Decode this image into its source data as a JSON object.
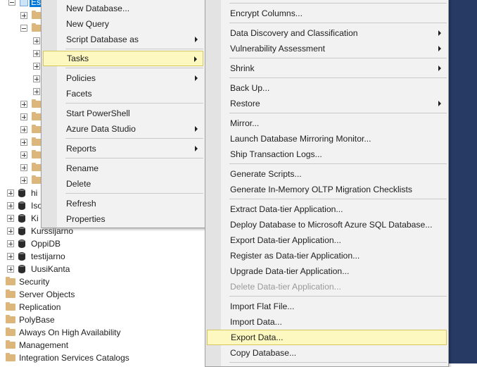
{
  "tree": {
    "selected_db": "Es",
    "databases": [
      "hi",
      "Iso",
      "Ki",
      "Kurssijarno",
      "OppiDB",
      "testijarno",
      "UusiKanta"
    ],
    "root_folders": [
      "Security",
      "Server Objects",
      "Replication",
      "PolyBase",
      "Always On High Availability",
      "Management",
      "Integration Services Catalogs"
    ]
  },
  "context_menu": {
    "items": [
      {
        "label": "New Database..."
      },
      {
        "label": "New Query"
      },
      {
        "label": "Script Database as"
      },
      {
        "label": "Tasks"
      },
      {
        "label": "Policies"
      },
      {
        "label": "Facets"
      },
      {
        "label": "Start PowerShell"
      },
      {
        "label": "Azure Data Studio"
      },
      {
        "label": "Reports"
      },
      {
        "label": "Rename"
      },
      {
        "label": "Delete"
      },
      {
        "label": "Refresh"
      },
      {
        "label": "Properties"
      }
    ]
  },
  "tasks_submenu": {
    "items": [
      {
        "label": "Encrypt Columns..."
      },
      {
        "label": "Data Discovery and Classification"
      },
      {
        "label": "Vulnerability Assessment"
      },
      {
        "label": "Shrink"
      },
      {
        "label": "Back Up..."
      },
      {
        "label": "Restore"
      },
      {
        "label": "Mirror..."
      },
      {
        "label": "Launch Database Mirroring Monitor..."
      },
      {
        "label": "Ship Transaction Logs..."
      },
      {
        "label": "Generate Scripts..."
      },
      {
        "label": "Generate In-Memory OLTP Migration Checklists"
      },
      {
        "label": "Extract Data-tier Application..."
      },
      {
        "label": "Deploy Database to Microsoft Azure SQL Database..."
      },
      {
        "label": "Export Data-tier Application..."
      },
      {
        "label": "Register as Data-tier Application..."
      },
      {
        "label": "Upgrade Data-tier Application..."
      },
      {
        "label": "Delete Data-tier Application..."
      },
      {
        "label": "Import Flat File..."
      },
      {
        "label": "Import Data..."
      },
      {
        "label": "Export Data..."
      },
      {
        "label": "Copy Database..."
      }
    ]
  },
  "colors": {
    "menu_bg": "#f2f2f2",
    "highlight": "#fcf8c0",
    "highlight_border": "#d6c65b",
    "selection": "#0078d7",
    "window_bg_dark": "#273a63"
  }
}
